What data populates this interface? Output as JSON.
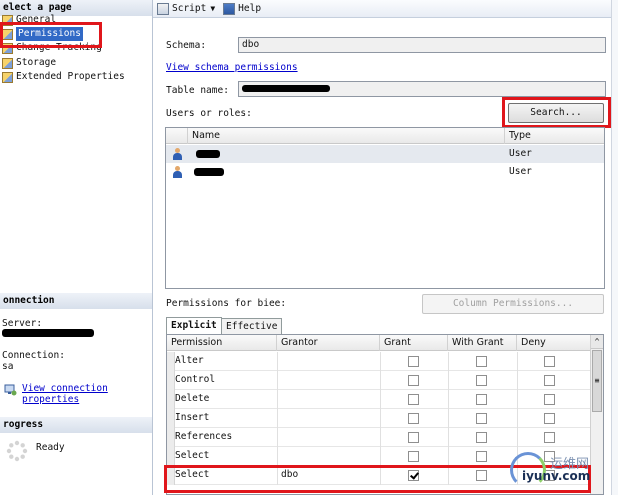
{
  "left_pane": {
    "select_page_header": "elect a page",
    "pages": [
      {
        "label": "General",
        "selected": false
      },
      {
        "label": "Permissions",
        "selected": true
      },
      {
        "label": "Change Tracking",
        "selected": false
      },
      {
        "label": "Storage",
        "selected": false
      },
      {
        "label": "Extended Properties",
        "selected": false
      }
    ],
    "connection_header": "onnection",
    "server_label": "Server:",
    "connection_label": "Connection:",
    "connection_value": "sa",
    "view_connection_link": [
      "View connection",
      "properties"
    ],
    "progress_header": "rogress",
    "progress_status": "Ready"
  },
  "toolbar": {
    "script_label": "Script",
    "help_label": "Help",
    "icons": [
      "script-icon",
      "help-icon"
    ]
  },
  "schema": {
    "label": "Schema:",
    "value": "dbo",
    "view_link": "View schema permissions"
  },
  "table_name": {
    "label": "Table name:"
  },
  "users_or_roles": {
    "label": "Users or roles:",
    "search_button": "Search...",
    "columns": [
      "Name",
      "Type"
    ],
    "rows": [
      {
        "type": "User",
        "selected": true
      },
      {
        "type": "User",
        "selected": false
      }
    ]
  },
  "permissions": {
    "label": "Permissions for biee:",
    "column_permissions_button": "Column Permissions...",
    "tabs": [
      {
        "label": "Explicit",
        "active": true
      },
      {
        "label": "Effective",
        "active": false
      }
    ],
    "columns": [
      "Permission",
      "Grantor",
      "Grant",
      "With Grant",
      "Deny"
    ],
    "rows": [
      {
        "permission": "Alter",
        "grantor": "",
        "grant": false,
        "with_grant": false,
        "deny": false
      },
      {
        "permission": "Control",
        "grantor": "",
        "grant": false,
        "with_grant": false,
        "deny": false
      },
      {
        "permission": "Delete",
        "grantor": "",
        "grant": false,
        "with_grant": false,
        "deny": false
      },
      {
        "permission": "Insert",
        "grantor": "",
        "grant": false,
        "with_grant": false,
        "deny": false
      },
      {
        "permission": "References",
        "grantor": "",
        "grant": false,
        "with_grant": false,
        "deny": false
      },
      {
        "permission": "Select",
        "grantor": "",
        "grant": false,
        "with_grant": false,
        "deny": false
      },
      {
        "permission": "Select",
        "grantor": "dbo",
        "grant": true,
        "with_grant": false,
        "deny": false
      }
    ]
  },
  "watermark": {
    "cn": "运维网",
    "en": "iyunv.com"
  },
  "colors": {
    "highlight_red": "#e0161b",
    "selection_blue": "#3169c6",
    "link_blue": "#0000cc"
  }
}
